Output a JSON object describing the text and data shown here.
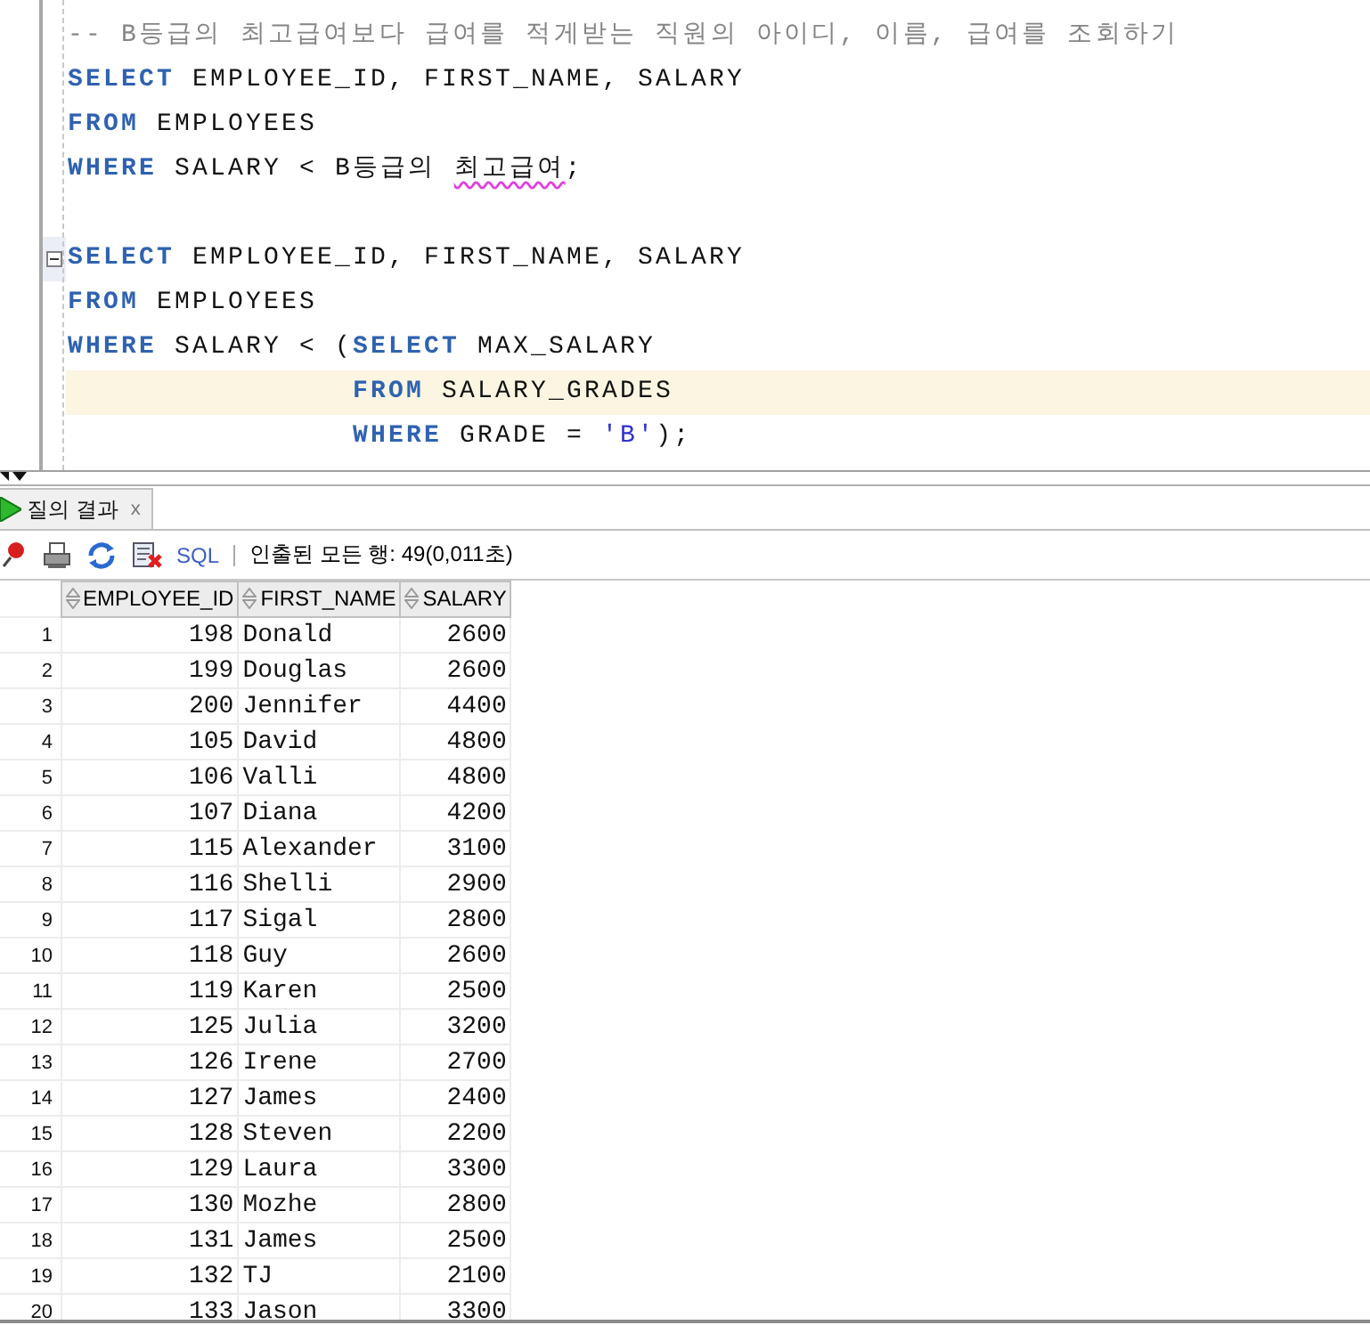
{
  "editor": {
    "statements": [
      {
        "lines": [
          {
            "highlighted": false,
            "fold_marker": false,
            "tokens": [
              {
                "kind": "comment",
                "text": "-- B등급의 최고급여보다 급여를 적게받는 직원의 아이디, 이름, 급여를 조회하기"
              }
            ]
          },
          {
            "highlighted": false,
            "fold_marker": false,
            "tokens": [
              {
                "kind": "keyword",
                "text": "SELECT"
              },
              {
                "kind": "plain",
                "text": " EMPLOYEE_ID, FIRST_NAME, SALARY"
              }
            ]
          },
          {
            "highlighted": false,
            "fold_marker": false,
            "tokens": [
              {
                "kind": "keyword",
                "text": "FROM"
              },
              {
                "kind": "plain",
                "text": " EMPLOYEES"
              }
            ]
          },
          {
            "highlighted": false,
            "fold_marker": false,
            "tokens": [
              {
                "kind": "keyword",
                "text": "WHERE"
              },
              {
                "kind": "plain",
                "text": " SALARY < B등급의 "
              },
              {
                "kind": "misspelled",
                "text": "최고급여"
              },
              {
                "kind": "plain",
                "text": ";"
              }
            ]
          }
        ]
      },
      {
        "lines": [
          {
            "highlighted": false,
            "fold_marker": true,
            "tokens": [
              {
                "kind": "keyword",
                "text": "SELECT"
              },
              {
                "kind": "plain",
                "text": " EMPLOYEE_ID, FIRST_NAME, SALARY"
              }
            ]
          },
          {
            "highlighted": false,
            "fold_marker": false,
            "tokens": [
              {
                "kind": "keyword",
                "text": "FROM"
              },
              {
                "kind": "plain",
                "text": " EMPLOYEES"
              }
            ]
          },
          {
            "highlighted": false,
            "fold_marker": false,
            "tokens": [
              {
                "kind": "keyword",
                "text": "WHERE"
              },
              {
                "kind": "plain",
                "text": " SALARY < ("
              },
              {
                "kind": "keyword",
                "text": "SELECT"
              },
              {
                "kind": "plain",
                "text": " MAX_SALARY"
              }
            ]
          },
          {
            "highlighted": true,
            "fold_marker": false,
            "tokens": [
              {
                "kind": "keyword",
                "text": "                FROM"
              },
              {
                "kind": "plain",
                "text": " SALARY_GRADES"
              }
            ]
          },
          {
            "highlighted": false,
            "fold_marker": false,
            "tokens": [
              {
                "kind": "keyword",
                "text": "                WHERE"
              },
              {
                "kind": "plain",
                "text": " GRADE = "
              },
              {
                "kind": "string",
                "text": "'B'"
              },
              {
                "kind": "plain",
                "text": ");"
              }
            ]
          }
        ]
      }
    ]
  },
  "results": {
    "tab": {
      "label": "질의 결과",
      "close": "x",
      "selected": true
    },
    "toolbar": {
      "sql_link": "SQL",
      "status": "인출된 모든 행: 49(0,011초)"
    },
    "table": {
      "columns": [
        "",
        "EMPLOYEE_ID",
        "FIRST_NAME",
        "SALARY"
      ],
      "rows": [
        [
          "1",
          "198",
          "Donald",
          "2600"
        ],
        [
          "2",
          "199",
          "Douglas",
          "2600"
        ],
        [
          "3",
          "200",
          "Jennifer",
          "4400"
        ],
        [
          "4",
          "105",
          "David",
          "4800"
        ],
        [
          "5",
          "106",
          "Valli",
          "4800"
        ],
        [
          "6",
          "107",
          "Diana",
          "4200"
        ],
        [
          "7",
          "115",
          "Alexander",
          "3100"
        ],
        [
          "8",
          "116",
          "Shelli",
          "2900"
        ],
        [
          "9",
          "117",
          "Sigal",
          "2800"
        ],
        [
          "10",
          "118",
          "Guy",
          "2600"
        ],
        [
          "11",
          "119",
          "Karen",
          "2500"
        ],
        [
          "12",
          "125",
          "Julia",
          "3200"
        ],
        [
          "13",
          "126",
          "Irene",
          "2700"
        ],
        [
          "14",
          "127",
          "James",
          "2400"
        ],
        [
          "15",
          "128",
          "Steven",
          "2200"
        ],
        [
          "16",
          "129",
          "Laura",
          "3300"
        ],
        [
          "17",
          "130",
          "Mozhe",
          "2800"
        ],
        [
          "18",
          "131",
          "James",
          "2500"
        ],
        [
          "19",
          "132",
          "TJ",
          "2100"
        ],
        [
          "20",
          "133",
          "Jason",
          "3300"
        ]
      ]
    }
  }
}
